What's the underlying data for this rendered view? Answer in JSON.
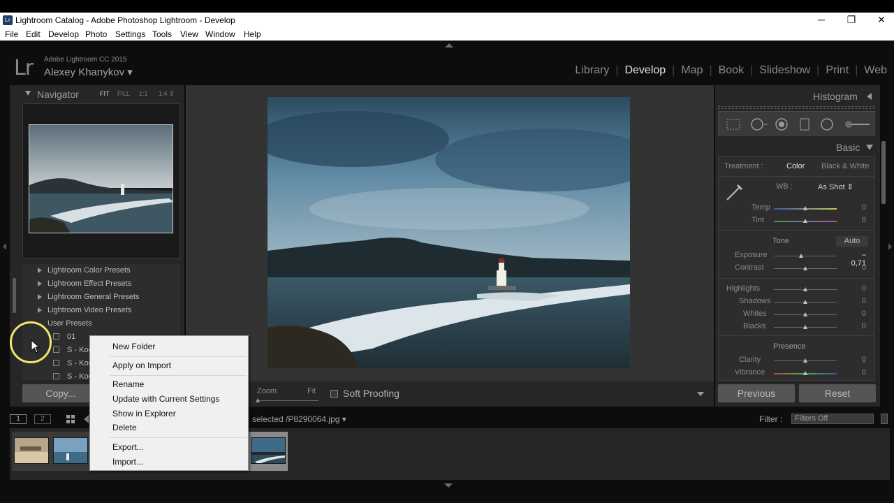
{
  "window": {
    "title": "Lightroom Catalog - Adobe Photoshop Lightroom - Develop",
    "app_badge": "Lr",
    "minimize": "─",
    "restore": "❐",
    "close": "✕"
  },
  "menu": [
    "File",
    "Edit",
    "Develop",
    "Photo",
    "Settings",
    "Tools",
    "View",
    "Window",
    "Help"
  ],
  "identity": {
    "logo": "Lr",
    "version": "Adobe Lightroom CC 2015",
    "user": "Alexey Khanykov ▾"
  },
  "modules": [
    "Library",
    "Develop",
    "Map",
    "Book",
    "Slideshow",
    "Print",
    "Web"
  ],
  "active_module": "Develop",
  "navigator": {
    "title": "Navigator",
    "options": [
      "FIT",
      "FILL",
      "1:1",
      "1:4 ⇕"
    ]
  },
  "presets": {
    "folders": [
      "Lightroom Color Presets",
      "Lightroom Effect Presets",
      "Lightroom General Presets",
      "Lightroom Video Presets",
      "User Presets"
    ],
    "items": [
      "01",
      "S - Koo",
      "S - Koo",
      "S - Koo"
    ]
  },
  "copy_button": "Copy...",
  "toolbar": {
    "zoom": "Zoom",
    "fit": "Fit",
    "soft_proofing": "Soft Proofing"
  },
  "right_panel": {
    "histogram": "Histogram",
    "basic": "Basic",
    "treatment_label": "Treatment :",
    "treatment_color": "Color",
    "treatment_bw": "Black & White",
    "wb_label": "WB :",
    "wb_value": "As Shot ⇕",
    "tone": "Tone",
    "auto": "Auto",
    "presence": "Presence",
    "sliders": [
      {
        "label": "Temp",
        "value": "0",
        "level": 0.5
      },
      {
        "label": "Tint",
        "value": "0",
        "level": 0.5
      },
      {
        "label": "Exposure",
        "value": "– 0,71",
        "level": 0.43
      },
      {
        "label": "Contrast",
        "value": "0",
        "level": 0.5
      },
      {
        "label": "Highlights",
        "value": "0",
        "level": 0.5
      },
      {
        "label": "Shadows",
        "value": "0",
        "level": 0.5
      },
      {
        "label": "Whites",
        "value": "0",
        "level": 0.5
      },
      {
        "label": "Blacks",
        "value": "0",
        "level": 0.5
      },
      {
        "label": "Clarity",
        "value": "0",
        "level": 0.5
      },
      {
        "label": "Vibrance",
        "value": "0",
        "level": 0.5
      }
    ],
    "previous": "Previous",
    "reset": "Reset"
  },
  "filmstrip": {
    "view1": "1",
    "view2": "2",
    "selected_text": "selected /P8290064.jpg ▾",
    "filter_label": "Filter :",
    "filter_value": "Filters Off"
  },
  "context_menu": {
    "items": [
      "New Folder",
      "Apply on Import",
      "Rename",
      "Update with Current Settings",
      "Show in Explorer",
      "Delete",
      "Export...",
      "Import..."
    ]
  },
  "colors": {
    "panel": "#262626",
    "canvas": "#333333",
    "active_text": "#e6e6e6",
    "cursor_ring": "#f2e56a"
  }
}
